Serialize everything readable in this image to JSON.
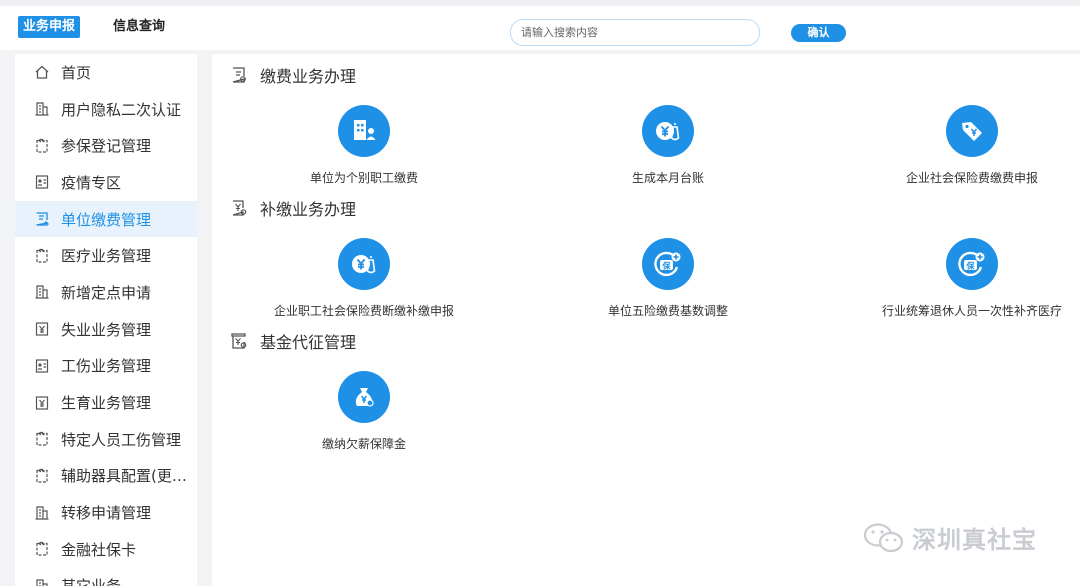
{
  "header": {
    "tabs": [
      {
        "label": "业务申报",
        "active": true
      },
      {
        "label": "信息查询",
        "active": false
      }
    ],
    "search_placeholder": "请输入搜索内容",
    "confirm_label": "确认"
  },
  "sidebar": {
    "items": [
      {
        "label": "首页",
        "icon": "home-icon"
      },
      {
        "label": "用户隐私二次认证",
        "icon": "building-icon"
      },
      {
        "label": "参保登记管理",
        "icon": "clipboard-icon"
      },
      {
        "label": "疫情专区",
        "icon": "id-card-icon"
      },
      {
        "label": "单位缴费管理",
        "icon": "form-icon",
        "active": true
      },
      {
        "label": "医疗业务管理",
        "icon": "clipboard-icon"
      },
      {
        "label": "新增定点申请",
        "icon": "building-icon"
      },
      {
        "label": "失业业务管理",
        "icon": "yen-doc-icon"
      },
      {
        "label": "工伤业务管理",
        "icon": "id-card-icon"
      },
      {
        "label": "生育业务管理",
        "icon": "yen-doc-icon"
      },
      {
        "label": "特定人员工伤管理",
        "icon": "clipboard-icon"
      },
      {
        "label": "辅助器具配置(更换...",
        "icon": "clipboard-icon"
      },
      {
        "label": "转移申请管理",
        "icon": "building-icon"
      },
      {
        "label": "金融社保卡",
        "icon": "clipboard-icon"
      },
      {
        "label": "其它业务",
        "icon": "building-icon"
      }
    ]
  },
  "main": {
    "sections": [
      {
        "title": "缴费业务办理",
        "tiles": [
          {
            "label": "单位为个别职工缴费",
            "icon": "building-person-icon"
          },
          {
            "label": "生成本月台账",
            "icon": "yen-bag-icon"
          },
          {
            "label": "企业社会保险费缴费申报",
            "icon": "yen-tag-icon"
          }
        ]
      },
      {
        "title": "补缴业务办理",
        "tiles": [
          {
            "label": "企业职工社会保险费断缴补缴申报",
            "icon": "yen-bag-icon"
          },
          {
            "label": "单位五险缴费基数调整",
            "icon": "insurance-add-icon"
          },
          {
            "label": "行业统筹退休人员一次性补齐医疗",
            "icon": "insurance-add-icon"
          }
        ]
      },
      {
        "title": "基金代征管理",
        "tiles": [
          {
            "label": "缴纳欠薪保障金",
            "icon": "money-bag-icon"
          }
        ]
      }
    ]
  },
  "watermark": {
    "text": "深圳真社宝"
  },
  "colors": {
    "accent": "#1e90e6",
    "active_bg": "#e8f2fc",
    "gap_bg": "#f2f3f5"
  }
}
